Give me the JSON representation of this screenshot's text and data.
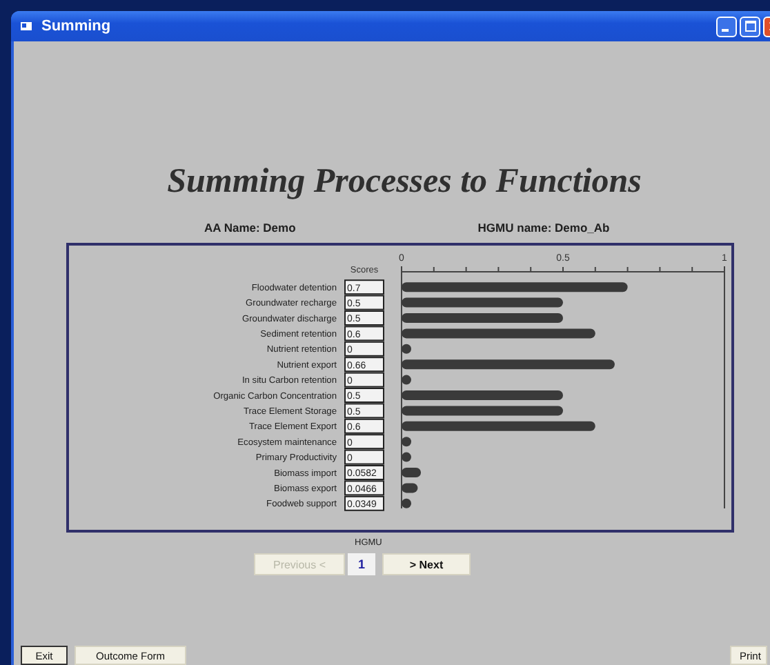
{
  "window": {
    "title": "Summing"
  },
  "heading": "Summing Processes to Functions",
  "aa_name": "AA Name: Demo",
  "hgmu_name": "HGMU name: Demo_Ab",
  "scores_header": "Scores",
  "scores": [
    "0.7",
    "0.5",
    "0.5",
    "0.6",
    "0",
    "0.66",
    "0",
    "0.5",
    "0.5",
    "0.6",
    "0",
    "0",
    "0.0582",
    "0.0466",
    "0.0349"
  ],
  "chart_data": {
    "type": "bar",
    "orientation": "horizontal",
    "categories": [
      "Floodwater detention",
      "Groundwater recharge",
      "Groundwater discharge",
      "Sediment retention",
      "Nutrient retention",
      "Nutrient export",
      "In situ Carbon retention",
      "Organic Carbon Concentration",
      "Trace Element Storage",
      "Trace Element Export",
      "Ecosystem maintenance",
      "Primary Productivity",
      "Biomass import",
      "Biomass export",
      "Foodweb support"
    ],
    "values": [
      0.7,
      0.5,
      0.5,
      0.6,
      0,
      0.66,
      0,
      0.5,
      0.5,
      0.6,
      0,
      0,
      0.06,
      0.05,
      0.03
    ],
    "xlim": [
      0,
      1
    ],
    "xticks": [
      0,
      0.5,
      1
    ]
  },
  "pager": {
    "label": "HGMU",
    "previous": {
      "label": "Previous <",
      "disabled": true
    },
    "page": "1",
    "next": {
      "label": "> Next",
      "disabled": false
    }
  },
  "bottom_buttons": [
    {
      "label": "Exit",
      "default": true
    },
    {
      "label": "Outcome Form",
      "default": false
    }
  ],
  "print_button": {
    "label": "Print",
    "default": false
  }
}
